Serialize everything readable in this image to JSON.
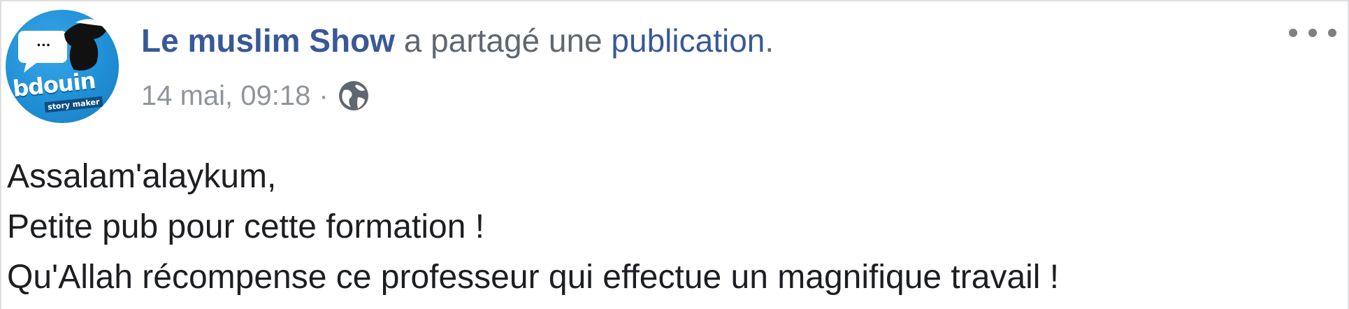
{
  "post": {
    "author_name": "Le muslim Show",
    "action_text": " a partagé une ",
    "link_text": "publication",
    "after_link": ".",
    "timestamp": "14 mai, 09:18",
    "separator": "·",
    "privacy_icon": "globe-icon",
    "more_icon": "more-options-icon",
    "avatar": {
      "brand_text": "bdouin",
      "sub_text": "story maker",
      "bubble_text": "...",
      "color": "#1f8fd6"
    },
    "body_lines": [
      "Assalam'alaykum,",
      "Petite pub pour cette formation !",
      "Qu'Allah récompense ce professeur qui effectue un magnifique travail !"
    ]
  },
  "colors": {
    "link": "#385898",
    "meta": "#90949c",
    "text": "#1c1e21"
  }
}
